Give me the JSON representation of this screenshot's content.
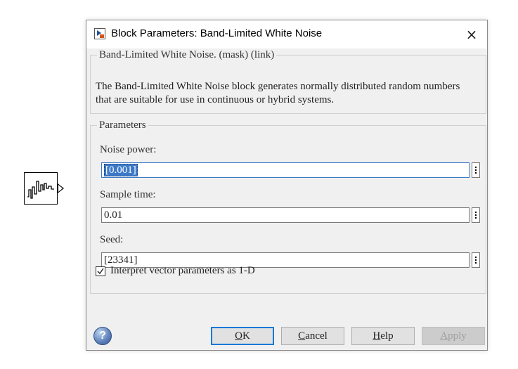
{
  "canvas": {
    "block_icon": "band-limited-noise-block-icon"
  },
  "dialog": {
    "title": "Block Parameters: Band-Limited White Noise",
    "close_icon": "×",
    "description_group": {
      "legend": "Band-Limited White Noise. (mask) (link)",
      "text": "The Band-Limited White Noise block generates normally distributed random numbers that are suitable for use in continuous or hybrid systems."
    },
    "parameters_group": {
      "legend": "Parameters",
      "noise_power": {
        "label": "Noise power:",
        "value": "[0.001]"
      },
      "sample_time": {
        "label": "Sample time:",
        "value": "0.01"
      },
      "seed": {
        "label": "Seed:",
        "value": "[23341]"
      },
      "interpret_checkbox": {
        "label": "Interpret vector parameters as 1-D",
        "checked": true
      }
    },
    "buttons": {
      "help_icon": "?",
      "ok": {
        "first": "O",
        "rest": "K"
      },
      "cancel": {
        "first": "C",
        "rest": "ancel"
      },
      "help": {
        "first": "H",
        "rest": "elp"
      },
      "apply": {
        "first": "A",
        "rest": "pply"
      }
    },
    "colors": {
      "accent": "#3c79c8",
      "default_button_border": "#0078d7"
    }
  }
}
